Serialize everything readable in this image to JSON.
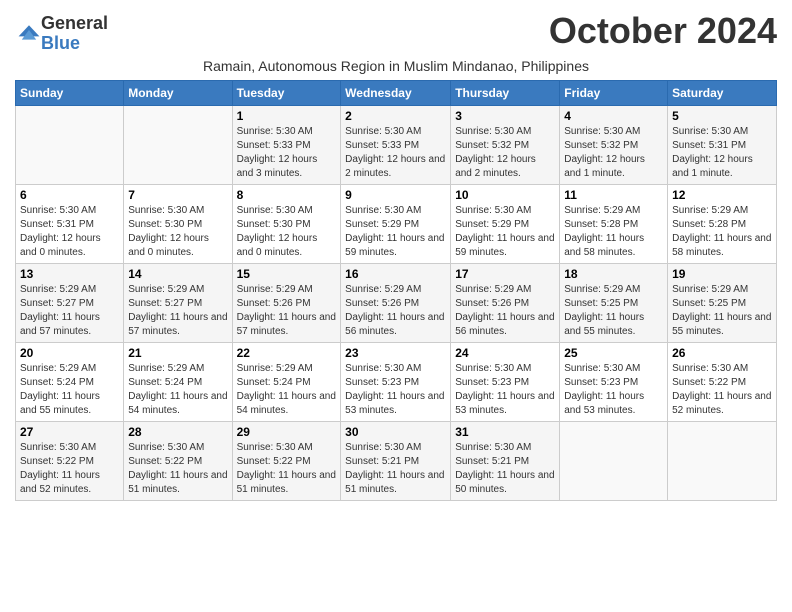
{
  "header": {
    "logo_general": "General",
    "logo_blue": "Blue",
    "month_year": "October 2024",
    "subtitle": "Ramain, Autonomous Region in Muslim Mindanao, Philippines"
  },
  "weekdays": [
    "Sunday",
    "Monday",
    "Tuesday",
    "Wednesday",
    "Thursday",
    "Friday",
    "Saturday"
  ],
  "weeks": [
    [
      {
        "day": "",
        "info": ""
      },
      {
        "day": "",
        "info": ""
      },
      {
        "day": "1",
        "info": "Sunrise: 5:30 AM\nSunset: 5:33 PM\nDaylight: 12 hours and 3 minutes."
      },
      {
        "day": "2",
        "info": "Sunrise: 5:30 AM\nSunset: 5:33 PM\nDaylight: 12 hours and 2 minutes."
      },
      {
        "day": "3",
        "info": "Sunrise: 5:30 AM\nSunset: 5:32 PM\nDaylight: 12 hours and 2 minutes."
      },
      {
        "day": "4",
        "info": "Sunrise: 5:30 AM\nSunset: 5:32 PM\nDaylight: 12 hours and 1 minute."
      },
      {
        "day": "5",
        "info": "Sunrise: 5:30 AM\nSunset: 5:31 PM\nDaylight: 12 hours and 1 minute."
      }
    ],
    [
      {
        "day": "6",
        "info": "Sunrise: 5:30 AM\nSunset: 5:31 PM\nDaylight: 12 hours and 0 minutes."
      },
      {
        "day": "7",
        "info": "Sunrise: 5:30 AM\nSunset: 5:30 PM\nDaylight: 12 hours and 0 minutes."
      },
      {
        "day": "8",
        "info": "Sunrise: 5:30 AM\nSunset: 5:30 PM\nDaylight: 12 hours and 0 minutes."
      },
      {
        "day": "9",
        "info": "Sunrise: 5:30 AM\nSunset: 5:29 PM\nDaylight: 11 hours and 59 minutes."
      },
      {
        "day": "10",
        "info": "Sunrise: 5:30 AM\nSunset: 5:29 PM\nDaylight: 11 hours and 59 minutes."
      },
      {
        "day": "11",
        "info": "Sunrise: 5:29 AM\nSunset: 5:28 PM\nDaylight: 11 hours and 58 minutes."
      },
      {
        "day": "12",
        "info": "Sunrise: 5:29 AM\nSunset: 5:28 PM\nDaylight: 11 hours and 58 minutes."
      }
    ],
    [
      {
        "day": "13",
        "info": "Sunrise: 5:29 AM\nSunset: 5:27 PM\nDaylight: 11 hours and 57 minutes."
      },
      {
        "day": "14",
        "info": "Sunrise: 5:29 AM\nSunset: 5:27 PM\nDaylight: 11 hours and 57 minutes."
      },
      {
        "day": "15",
        "info": "Sunrise: 5:29 AM\nSunset: 5:26 PM\nDaylight: 11 hours and 57 minutes."
      },
      {
        "day": "16",
        "info": "Sunrise: 5:29 AM\nSunset: 5:26 PM\nDaylight: 11 hours and 56 minutes."
      },
      {
        "day": "17",
        "info": "Sunrise: 5:29 AM\nSunset: 5:26 PM\nDaylight: 11 hours and 56 minutes."
      },
      {
        "day": "18",
        "info": "Sunrise: 5:29 AM\nSunset: 5:25 PM\nDaylight: 11 hours and 55 minutes."
      },
      {
        "day": "19",
        "info": "Sunrise: 5:29 AM\nSunset: 5:25 PM\nDaylight: 11 hours and 55 minutes."
      }
    ],
    [
      {
        "day": "20",
        "info": "Sunrise: 5:29 AM\nSunset: 5:24 PM\nDaylight: 11 hours and 55 minutes."
      },
      {
        "day": "21",
        "info": "Sunrise: 5:29 AM\nSunset: 5:24 PM\nDaylight: 11 hours and 54 minutes."
      },
      {
        "day": "22",
        "info": "Sunrise: 5:29 AM\nSunset: 5:24 PM\nDaylight: 11 hours and 54 minutes."
      },
      {
        "day": "23",
        "info": "Sunrise: 5:30 AM\nSunset: 5:23 PM\nDaylight: 11 hours and 53 minutes."
      },
      {
        "day": "24",
        "info": "Sunrise: 5:30 AM\nSunset: 5:23 PM\nDaylight: 11 hours and 53 minutes."
      },
      {
        "day": "25",
        "info": "Sunrise: 5:30 AM\nSunset: 5:23 PM\nDaylight: 11 hours and 53 minutes."
      },
      {
        "day": "26",
        "info": "Sunrise: 5:30 AM\nSunset: 5:22 PM\nDaylight: 11 hours and 52 minutes."
      }
    ],
    [
      {
        "day": "27",
        "info": "Sunrise: 5:30 AM\nSunset: 5:22 PM\nDaylight: 11 hours and 52 minutes."
      },
      {
        "day": "28",
        "info": "Sunrise: 5:30 AM\nSunset: 5:22 PM\nDaylight: 11 hours and 51 minutes."
      },
      {
        "day": "29",
        "info": "Sunrise: 5:30 AM\nSunset: 5:22 PM\nDaylight: 11 hours and 51 minutes."
      },
      {
        "day": "30",
        "info": "Sunrise: 5:30 AM\nSunset: 5:21 PM\nDaylight: 11 hours and 51 minutes."
      },
      {
        "day": "31",
        "info": "Sunrise: 5:30 AM\nSunset: 5:21 PM\nDaylight: 11 hours and 50 minutes."
      },
      {
        "day": "",
        "info": ""
      },
      {
        "day": "",
        "info": ""
      }
    ]
  ]
}
